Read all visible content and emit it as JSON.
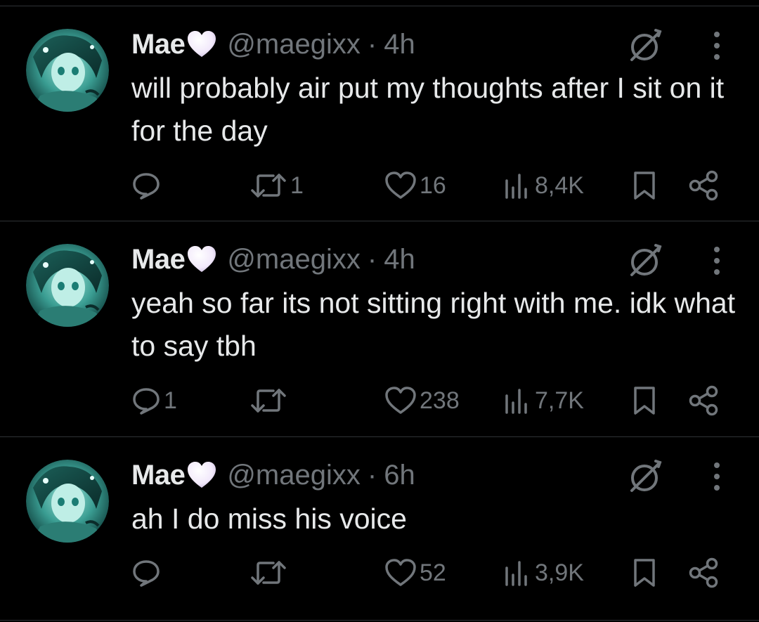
{
  "colors": {
    "background": "#000000",
    "primary_text": "#e7e9ea",
    "secondary_text": "#71767b",
    "divider": "#2f3336",
    "heart_emoji": "#f5eefc"
  },
  "tweets": [
    {
      "author": {
        "name": "Mae",
        "emoji": "white-heart",
        "handle": "@maegixx"
      },
      "separator": "·",
      "time": "4h",
      "text": "will probably air put my thoughts after I sit on it for the day",
      "metrics": {
        "replies": "",
        "retweets": "1",
        "likes": "16",
        "views": "8,4K"
      }
    },
    {
      "author": {
        "name": "Mae",
        "emoji": "white-heart",
        "handle": "@maegixx"
      },
      "separator": "·",
      "time": "4h",
      "text": "yeah so far its not sitting right with me. idk what to say tbh",
      "metrics": {
        "replies": "1",
        "retweets": "",
        "likes": "238",
        "views": "7,7K"
      }
    },
    {
      "author": {
        "name": "Mae",
        "emoji": "white-heart",
        "handle": "@maegixx"
      },
      "separator": "·",
      "time": "6h",
      "text": "ah I do miss his voice",
      "metrics": {
        "replies": "",
        "retweets": "",
        "likes": "52",
        "views": "3,9K"
      }
    }
  ],
  "icons": {
    "avatar": "anime-avatar",
    "grok": "grok-icon",
    "more": "more-dots-icon",
    "reply": "reply-icon",
    "retweet": "retweet-icon",
    "like": "like-heart-icon",
    "views": "views-chart-icon",
    "bookmark": "bookmark-icon",
    "share": "share-icon"
  }
}
